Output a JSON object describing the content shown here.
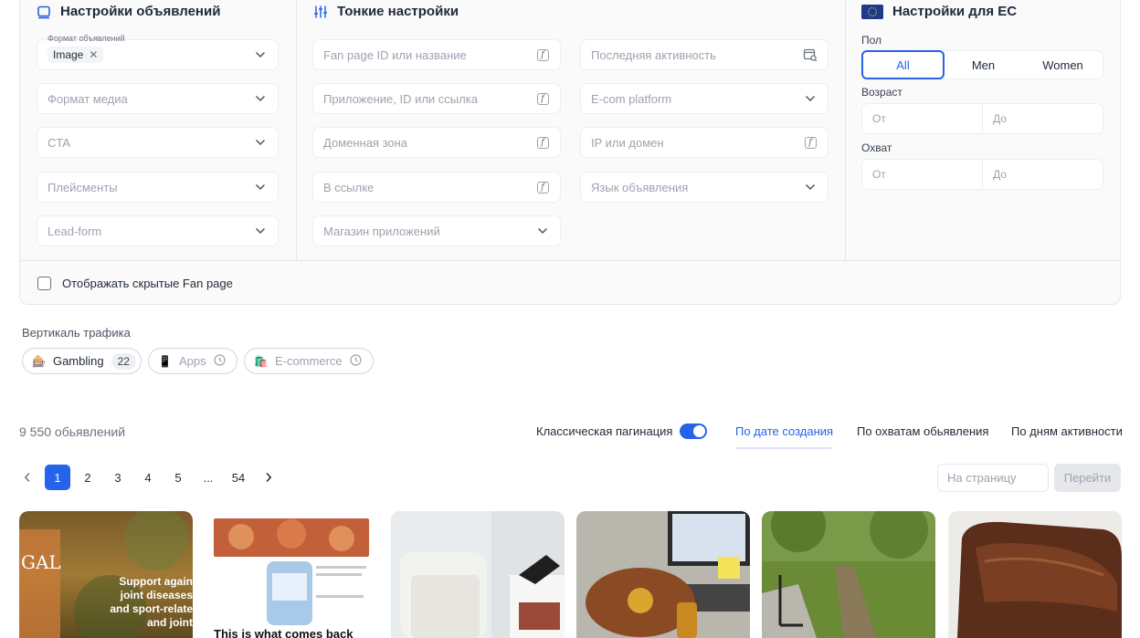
{
  "ad_settings": {
    "title": "Настройки объявлений",
    "format_label": "Формат объявлений",
    "format_chip": "Image",
    "media_format": "Формат медиа",
    "cta": "CTA",
    "placements": "Плейсменты",
    "lead_form": "Lead-form"
  },
  "fine_settings": {
    "title": "Тонкие настройки",
    "fan_page": "Fan page ID или название",
    "app": "Приложение, ID или ссылка",
    "domain_zone": "Доменная зона",
    "in_link": "В ссылке",
    "app_store": "Магазин приложений",
    "last_activity": "Последняя активность",
    "ecom": "E-com platform",
    "ip_domain": "IP или домен",
    "ad_language": "Язык объявления"
  },
  "eu_settings": {
    "title": "Настройки для ЕС",
    "gender_label": "Пол",
    "gender_options": [
      "All",
      "Men",
      "Women"
    ],
    "age_label": "Возраст",
    "reach_label": "Охват",
    "from": "От",
    "to": "До"
  },
  "hidden_fanpage": "Отображать скрытые Fan page",
  "vertical": {
    "title": "Вертикаль трафика",
    "items": [
      {
        "label": "Gambling",
        "count": "22"
      },
      {
        "label": "Apps"
      },
      {
        "label": "E-commerce"
      }
    ]
  },
  "results": {
    "count": "9 550 обьявлений",
    "classic_pagination": "Классическая пагинация",
    "sort_tabs": [
      "По дате создания",
      "По охватам обьявления",
      "По дням активности"
    ]
  },
  "pagination": {
    "pages": [
      "1",
      "2",
      "3",
      "4",
      "5",
      "...",
      "54"
    ],
    "active": "1",
    "per_page_placeholder": "На страницу",
    "go_label": "Перейти"
  },
  "cards": {
    "card1_text": [
      "Support again",
      "joint diseases",
      "and sport-relate",
      "and joint"
    ],
    "card1_brand": "GAL",
    "card2_text": "This is what comes back"
  },
  "colors": {
    "accent": "#2563eb",
    "eu_flag": "#1e3a8a"
  }
}
